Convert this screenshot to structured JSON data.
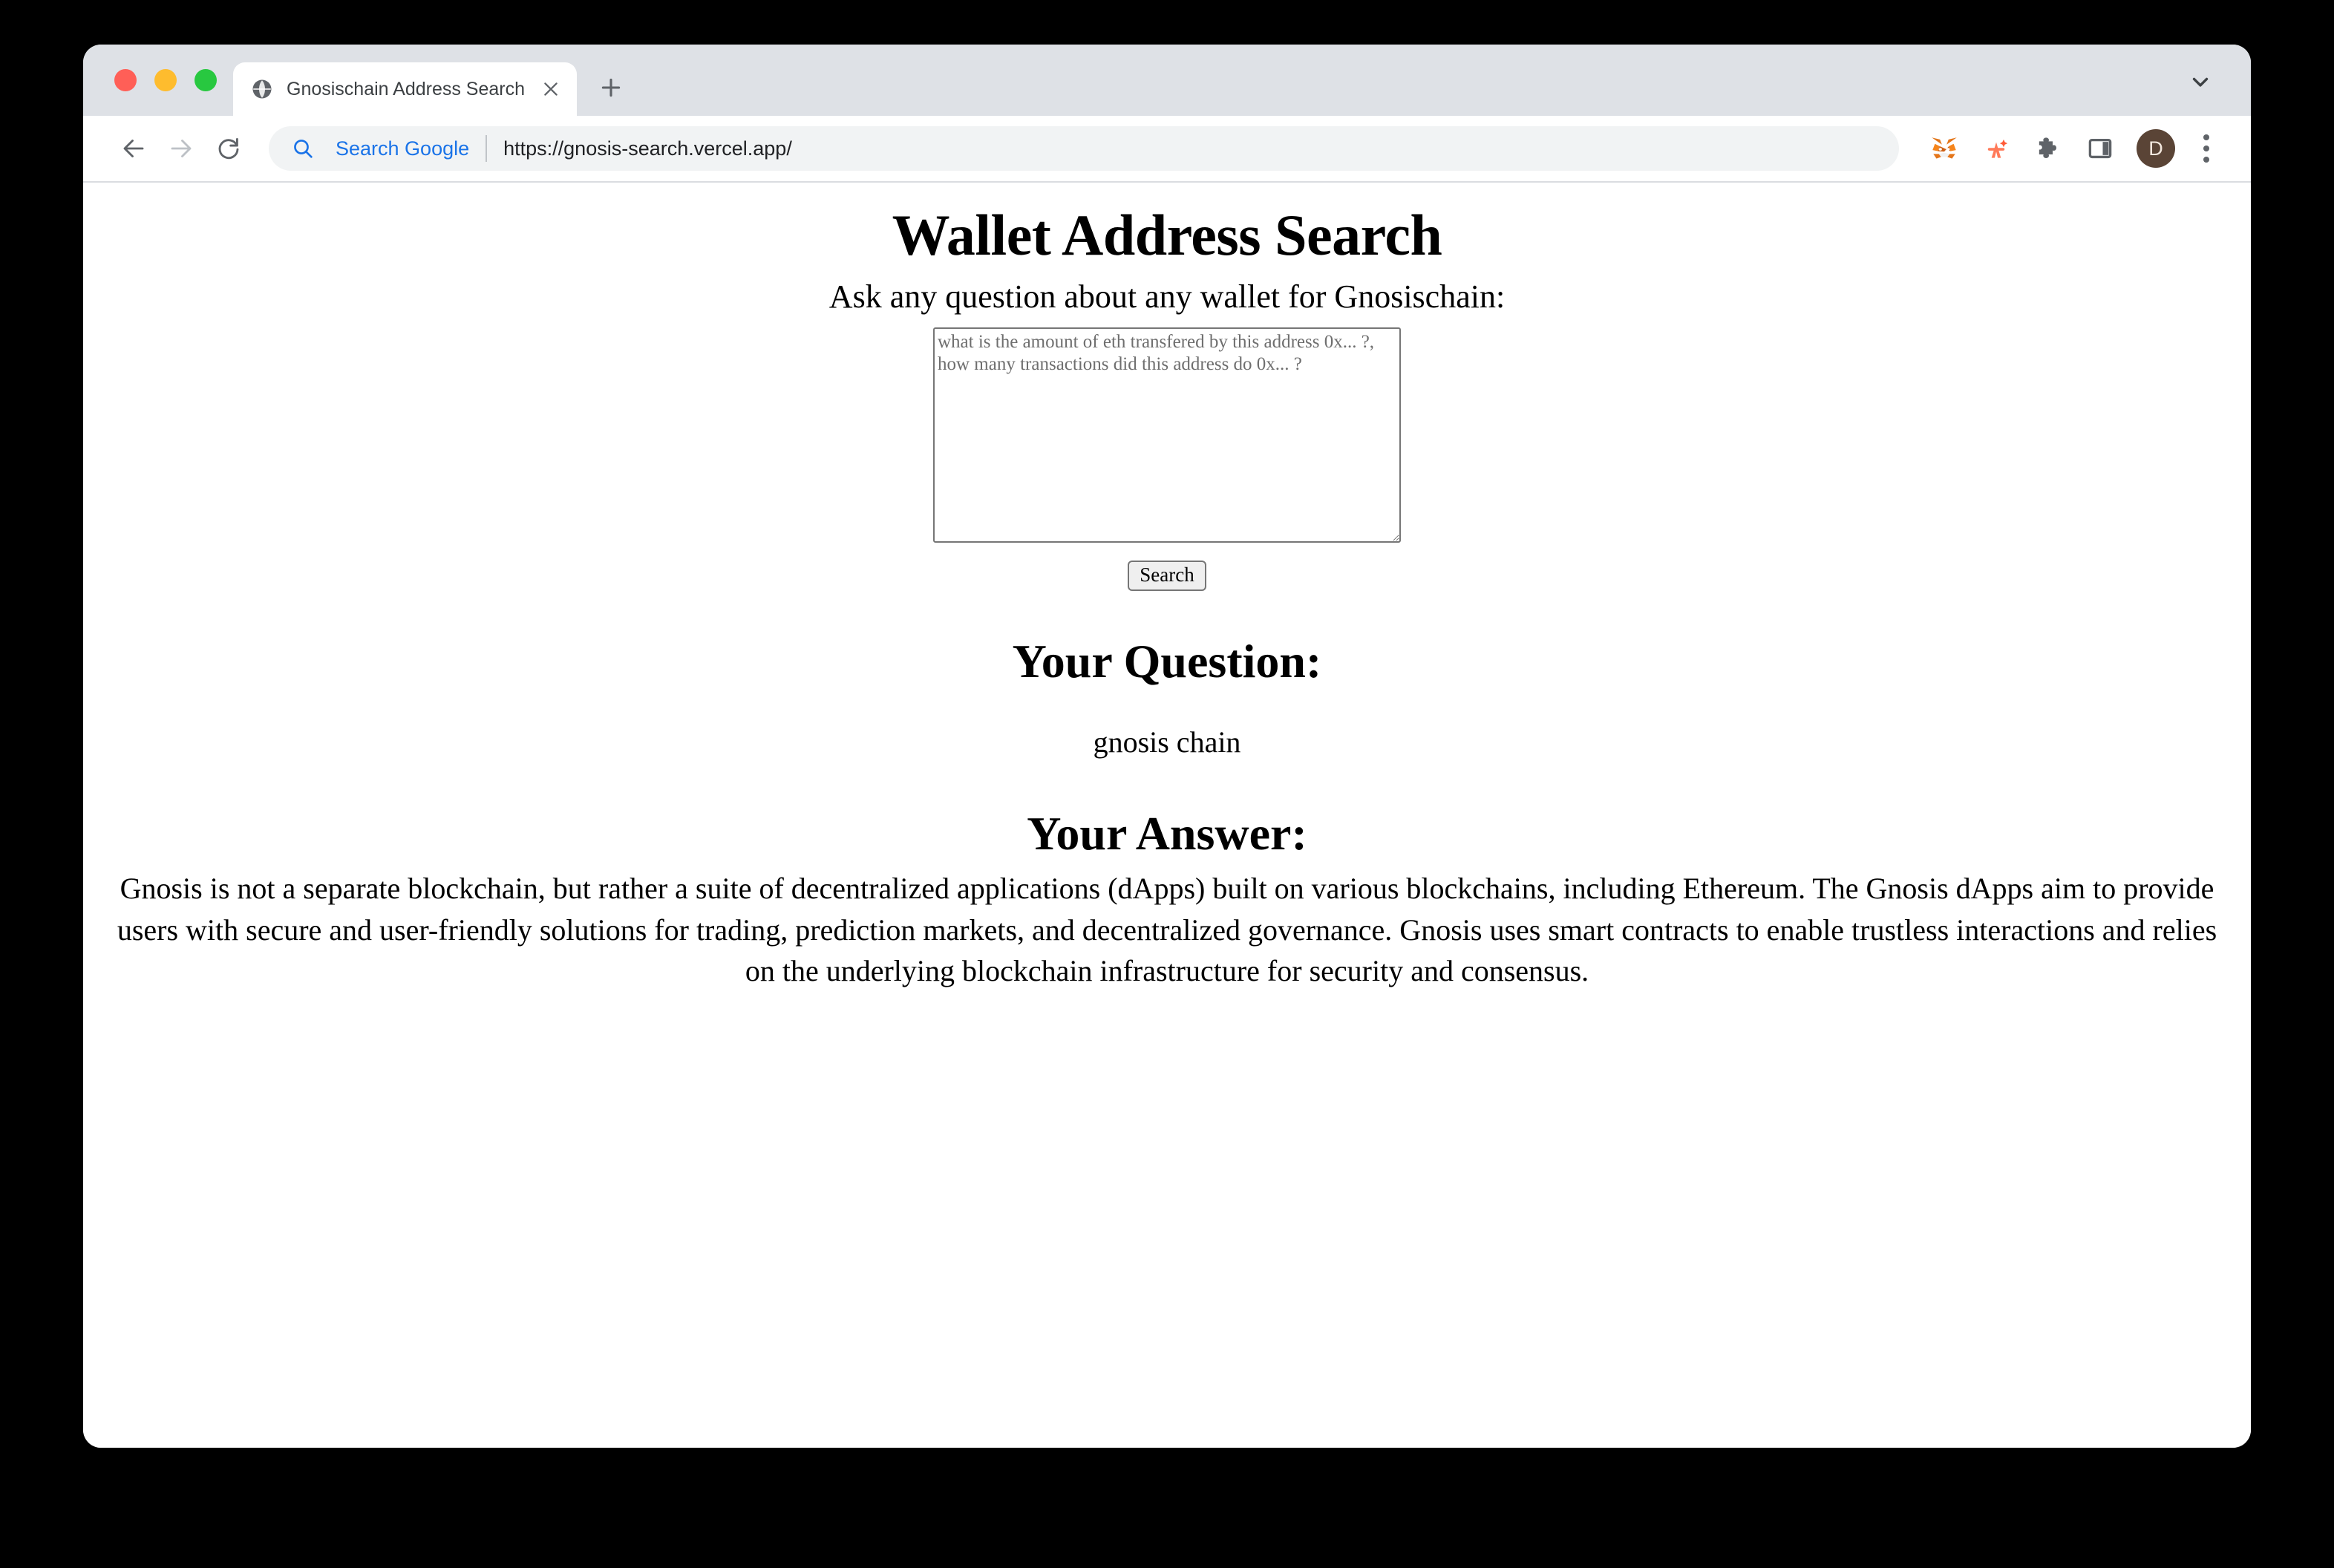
{
  "window": {
    "traffic_lights": [
      "close",
      "minimize",
      "maximize"
    ]
  },
  "tabstrip": {
    "tab_title": "Gnosischain Address Search",
    "favicon": "globe-icon",
    "close_icon": "close-icon",
    "new_tab_icon": "plus-icon",
    "tab_list_icon": "chevron-down-icon"
  },
  "toolbar": {
    "back_icon": "back-arrow-icon",
    "forward_icon": "forward-arrow-icon",
    "reload_icon": "reload-icon",
    "omnibox": {
      "search_icon": "search-icon",
      "search_label": "Search Google",
      "url": "https://gnosis-search.vercel.app/"
    },
    "extensions": [
      {
        "name": "metamask-icon"
      },
      {
        "name": "rabby-icon"
      },
      {
        "name": "puzzle-icon"
      },
      {
        "name": "side-panel-icon"
      }
    ],
    "profile_initial": "D",
    "menu_icon": "three-dot-menu-icon"
  },
  "page": {
    "title": "Wallet Address Search",
    "subtitle": "Ask any question about any wallet for Gnosischain:",
    "textarea": {
      "value": "",
      "placeholder": "what is the amount of eth transfered by this address 0x... ?,\nhow many transactions did this address do 0x... ?"
    },
    "search_button_label": "Search",
    "question_heading": "Your Question:",
    "question_text": "gnosis chain",
    "answer_heading": "Your Answer:",
    "answer_text": "Gnosis is not a separate blockchain, but rather a suite of decentralized applications (dApps) built on various blockchains, including Ethereum. The Gnosis dApps aim to provide users with secure and user-friendly solutions for trading, prediction markets, and decentralized governance. Gnosis uses smart contracts to enable trustless interactions and relies on the underlying blockchain infrastructure for security and consensus."
  },
  "colors": {
    "tabstrip_bg": "#dee1e6",
    "omnibox_bg": "#f1f3f4",
    "link_blue": "#1a73e8",
    "avatar_bg": "#5a4436",
    "page_bg": "#ffffff",
    "desktop_bg": "#000000"
  }
}
